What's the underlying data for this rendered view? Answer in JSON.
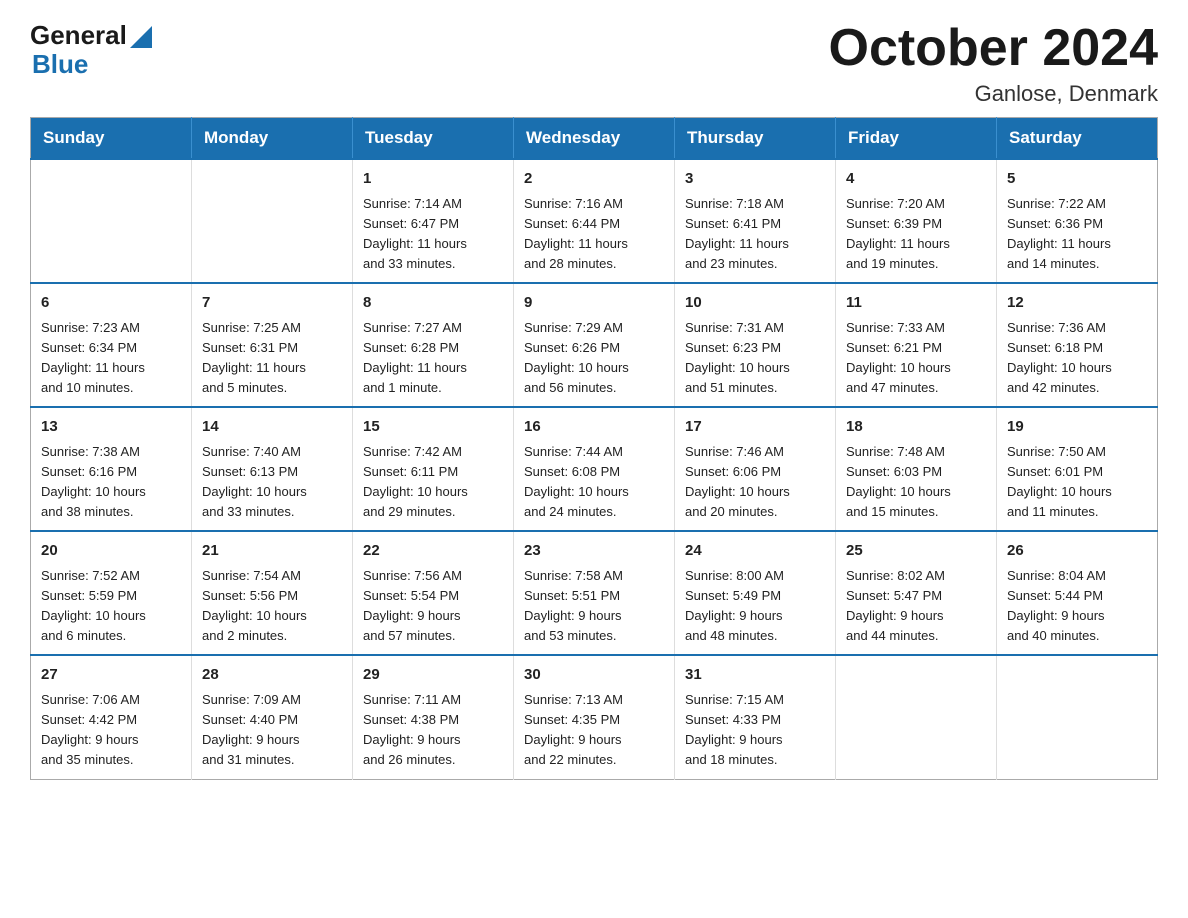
{
  "header": {
    "logo_general": "General",
    "logo_blue": "Blue",
    "month_title": "October 2024",
    "location": "Ganlose, Denmark"
  },
  "weekdays": [
    "Sunday",
    "Monday",
    "Tuesday",
    "Wednesday",
    "Thursday",
    "Friday",
    "Saturday"
  ],
  "weeks": [
    [
      {
        "day": "",
        "info": ""
      },
      {
        "day": "",
        "info": ""
      },
      {
        "day": "1",
        "info": "Sunrise: 7:14 AM\nSunset: 6:47 PM\nDaylight: 11 hours\nand 33 minutes."
      },
      {
        "day": "2",
        "info": "Sunrise: 7:16 AM\nSunset: 6:44 PM\nDaylight: 11 hours\nand 28 minutes."
      },
      {
        "day": "3",
        "info": "Sunrise: 7:18 AM\nSunset: 6:41 PM\nDaylight: 11 hours\nand 23 minutes."
      },
      {
        "day": "4",
        "info": "Sunrise: 7:20 AM\nSunset: 6:39 PM\nDaylight: 11 hours\nand 19 minutes."
      },
      {
        "day": "5",
        "info": "Sunrise: 7:22 AM\nSunset: 6:36 PM\nDaylight: 11 hours\nand 14 minutes."
      }
    ],
    [
      {
        "day": "6",
        "info": "Sunrise: 7:23 AM\nSunset: 6:34 PM\nDaylight: 11 hours\nand 10 minutes."
      },
      {
        "day": "7",
        "info": "Sunrise: 7:25 AM\nSunset: 6:31 PM\nDaylight: 11 hours\nand 5 minutes."
      },
      {
        "day": "8",
        "info": "Sunrise: 7:27 AM\nSunset: 6:28 PM\nDaylight: 11 hours\nand 1 minute."
      },
      {
        "day": "9",
        "info": "Sunrise: 7:29 AM\nSunset: 6:26 PM\nDaylight: 10 hours\nand 56 minutes."
      },
      {
        "day": "10",
        "info": "Sunrise: 7:31 AM\nSunset: 6:23 PM\nDaylight: 10 hours\nand 51 minutes."
      },
      {
        "day": "11",
        "info": "Sunrise: 7:33 AM\nSunset: 6:21 PM\nDaylight: 10 hours\nand 47 minutes."
      },
      {
        "day": "12",
        "info": "Sunrise: 7:36 AM\nSunset: 6:18 PM\nDaylight: 10 hours\nand 42 minutes."
      }
    ],
    [
      {
        "day": "13",
        "info": "Sunrise: 7:38 AM\nSunset: 6:16 PM\nDaylight: 10 hours\nand 38 minutes."
      },
      {
        "day": "14",
        "info": "Sunrise: 7:40 AM\nSunset: 6:13 PM\nDaylight: 10 hours\nand 33 minutes."
      },
      {
        "day": "15",
        "info": "Sunrise: 7:42 AM\nSunset: 6:11 PM\nDaylight: 10 hours\nand 29 minutes."
      },
      {
        "day": "16",
        "info": "Sunrise: 7:44 AM\nSunset: 6:08 PM\nDaylight: 10 hours\nand 24 minutes."
      },
      {
        "day": "17",
        "info": "Sunrise: 7:46 AM\nSunset: 6:06 PM\nDaylight: 10 hours\nand 20 minutes."
      },
      {
        "day": "18",
        "info": "Sunrise: 7:48 AM\nSunset: 6:03 PM\nDaylight: 10 hours\nand 15 minutes."
      },
      {
        "day": "19",
        "info": "Sunrise: 7:50 AM\nSunset: 6:01 PM\nDaylight: 10 hours\nand 11 minutes."
      }
    ],
    [
      {
        "day": "20",
        "info": "Sunrise: 7:52 AM\nSunset: 5:59 PM\nDaylight: 10 hours\nand 6 minutes."
      },
      {
        "day": "21",
        "info": "Sunrise: 7:54 AM\nSunset: 5:56 PM\nDaylight: 10 hours\nand 2 minutes."
      },
      {
        "day": "22",
        "info": "Sunrise: 7:56 AM\nSunset: 5:54 PM\nDaylight: 9 hours\nand 57 minutes."
      },
      {
        "day": "23",
        "info": "Sunrise: 7:58 AM\nSunset: 5:51 PM\nDaylight: 9 hours\nand 53 minutes."
      },
      {
        "day": "24",
        "info": "Sunrise: 8:00 AM\nSunset: 5:49 PM\nDaylight: 9 hours\nand 48 minutes."
      },
      {
        "day": "25",
        "info": "Sunrise: 8:02 AM\nSunset: 5:47 PM\nDaylight: 9 hours\nand 44 minutes."
      },
      {
        "day": "26",
        "info": "Sunrise: 8:04 AM\nSunset: 5:44 PM\nDaylight: 9 hours\nand 40 minutes."
      }
    ],
    [
      {
        "day": "27",
        "info": "Sunrise: 7:06 AM\nSunset: 4:42 PM\nDaylight: 9 hours\nand 35 minutes."
      },
      {
        "day": "28",
        "info": "Sunrise: 7:09 AM\nSunset: 4:40 PM\nDaylight: 9 hours\nand 31 minutes."
      },
      {
        "day": "29",
        "info": "Sunrise: 7:11 AM\nSunset: 4:38 PM\nDaylight: 9 hours\nand 26 minutes."
      },
      {
        "day": "30",
        "info": "Sunrise: 7:13 AM\nSunset: 4:35 PM\nDaylight: 9 hours\nand 22 minutes."
      },
      {
        "day": "31",
        "info": "Sunrise: 7:15 AM\nSunset: 4:33 PM\nDaylight: 9 hours\nand 18 minutes."
      },
      {
        "day": "",
        "info": ""
      },
      {
        "day": "",
        "info": ""
      }
    ]
  ]
}
